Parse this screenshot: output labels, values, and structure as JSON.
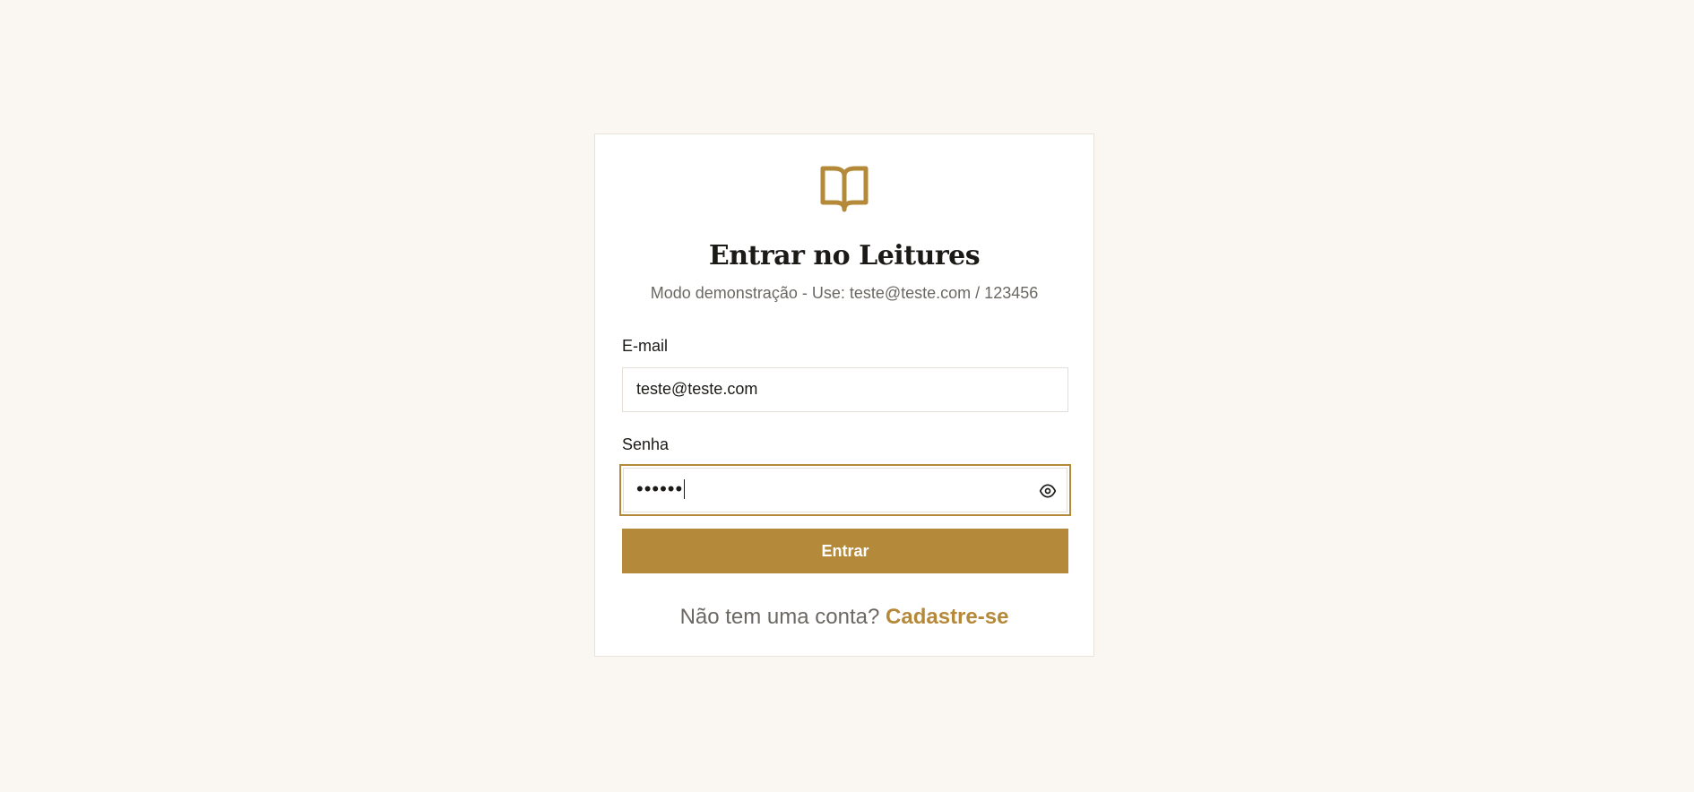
{
  "brand": {
    "accent_color": "#b5893a",
    "logo_icon": "book-open-icon"
  },
  "login": {
    "title": "Entrar no Leitures",
    "subtitle": "Modo demonstração - Use: teste@teste.com / 123456",
    "email_label": "E-mail",
    "email_value": "teste@teste.com",
    "password_label": "Senha",
    "password_masked": "••••••",
    "password_toggle_icon": "eye-icon",
    "submit_label": "Entrar",
    "signup_prompt": "Não tem uma conta?",
    "signup_link": "Cadastre-se"
  }
}
